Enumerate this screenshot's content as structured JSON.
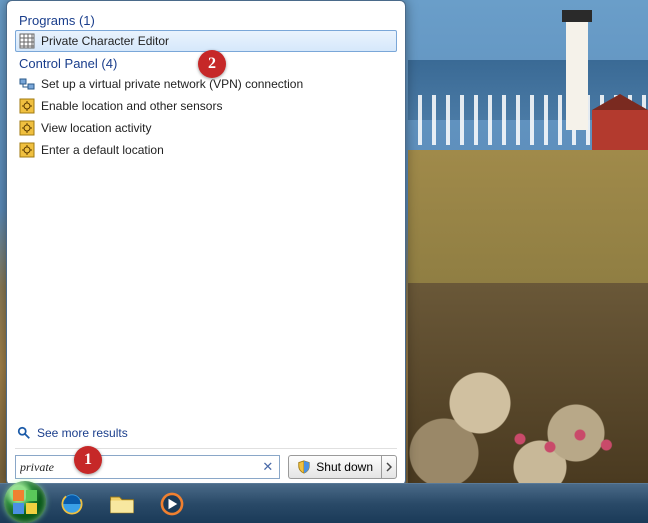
{
  "sections": {
    "programs": {
      "label": "Programs (1)"
    },
    "control_panel": {
      "label": "Control Panel (4)"
    }
  },
  "results": {
    "programs": [
      {
        "label": "Private Character Editor",
        "icon": "editor-grid"
      }
    ],
    "control_panel": [
      {
        "label": "Set up a virtual private network (VPN) connection",
        "icon": "network"
      },
      {
        "label": "Enable location and other sensors",
        "icon": "location"
      },
      {
        "label": "View location activity",
        "icon": "location"
      },
      {
        "label": "Enter a default location",
        "icon": "location"
      }
    ]
  },
  "see_more": "See more results",
  "search": {
    "value": "private"
  },
  "shutdown": {
    "label": "Shut down"
  },
  "markers": {
    "one": "1",
    "two": "2"
  }
}
